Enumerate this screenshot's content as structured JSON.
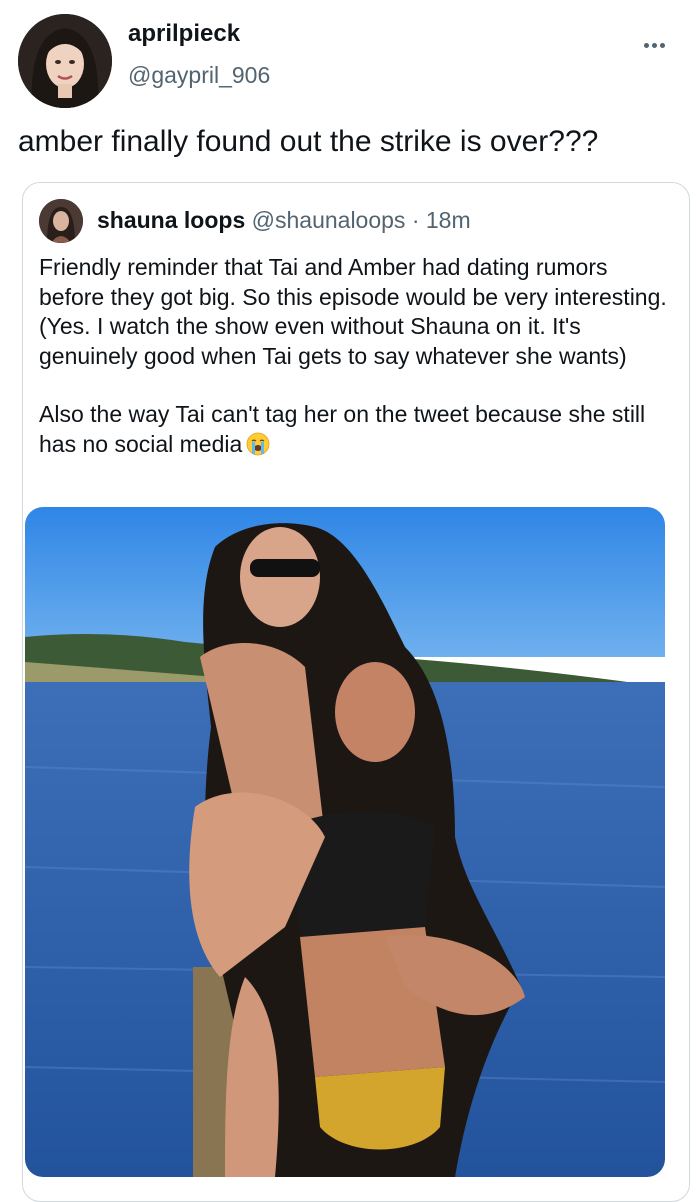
{
  "tweet": {
    "author": {
      "display_name": "aprilpieck",
      "handle": "@gaypril_906"
    },
    "text": "amber finally found out the strike is over???",
    "more_icon": "more-horizontal-icon"
  },
  "quoted_tweet": {
    "author": {
      "display_name": "shauna loops",
      "handle": "@shaunaloops",
      "separator": "·",
      "time": "18m"
    },
    "paragraphs": [
      "Friendly reminder that Tai and Amber had dating rumors before they got big. So this episode would be very interesting. (Yes. I watch the show even without Shauna on it. It's genuinely good when Tai gets to say whatever she wants)",
      "Also the way Tai can't tag her on the tweet because she still has no social media"
    ],
    "emoji": "loudly-crying-face-icon",
    "colors": {
      "sky": "#3f8fe0",
      "water": "#2b5fa8"
    }
  },
  "colors": {
    "text_primary": "#0f1419",
    "text_secondary": "#536471",
    "border": "#cfd9de"
  }
}
